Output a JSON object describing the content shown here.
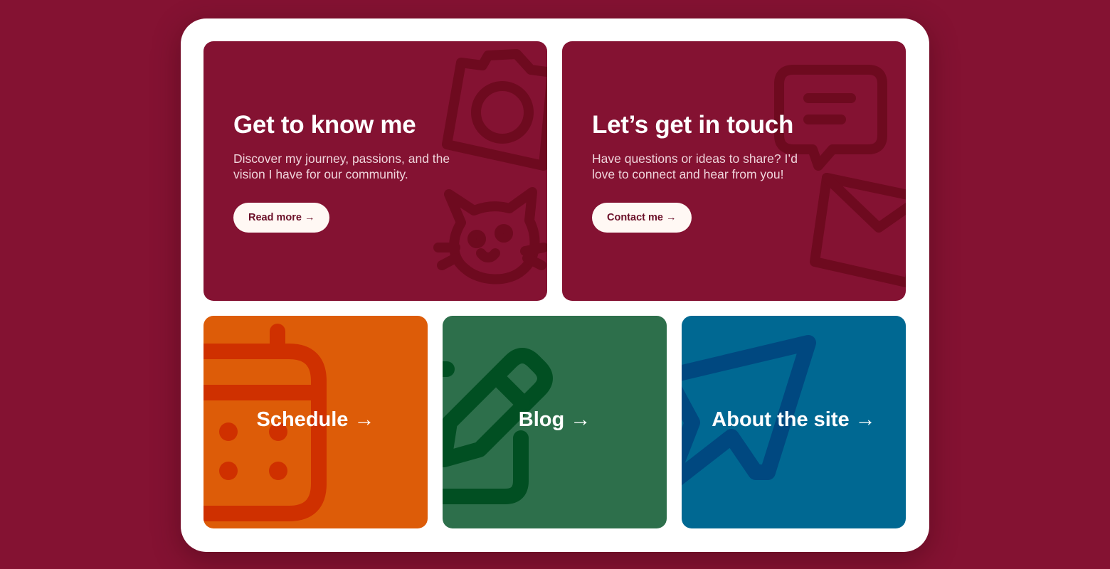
{
  "cards": {
    "about": {
      "title": "Get to know me",
      "description": "Discover my journey, passions, and the vision I have for our community.",
      "button": "Read more →",
      "icons": [
        "camera-icon",
        "cat-icon"
      ]
    },
    "touch": {
      "title": "Let’s get in touch",
      "description": "Have questions or ideas to share? I’d love to connect and hear from you!",
      "button": "Contact me →",
      "icons": [
        "chat-bubble-icon",
        "envelope-icon"
      ]
    }
  },
  "tiles": {
    "schedule": {
      "label": "Schedule →",
      "icon": "calendar-icon",
      "color": "#dd5c08"
    },
    "blog": {
      "label": "Blog →",
      "icon": "pencil-icon",
      "color": "#2d6f4b"
    },
    "site": {
      "label": "About the site →",
      "icon": "cursor-icon",
      "color": "#006892"
    }
  },
  "colors": {
    "page_background": "#841232",
    "card_background": "#841232",
    "frame": "#ffffff",
    "button_text": "#6b0f28"
  }
}
